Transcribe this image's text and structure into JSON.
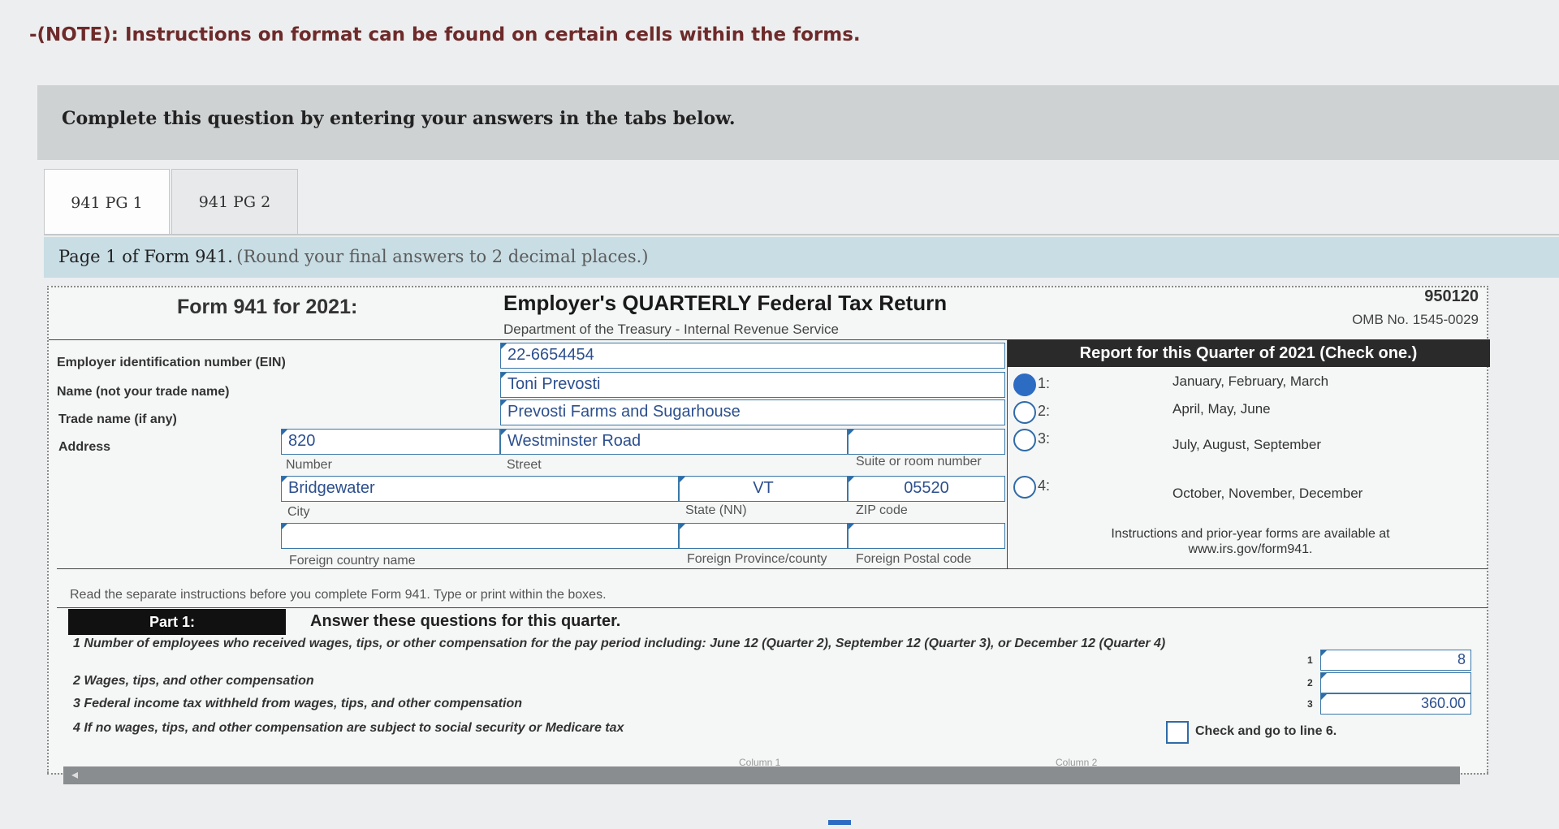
{
  "note": "-(NOTE): Instructions on format can be found on certain cells within the forms.",
  "prompt": "Complete this question by entering your answers in the tabs below.",
  "tabs": [
    {
      "label": "941 PG 1",
      "active": true
    },
    {
      "label": "941 PG 2",
      "active": false
    }
  ],
  "instructions": {
    "lead": "Page 1 of Form 941.",
    "paren": "(Round your final answers to 2 decimal places.)"
  },
  "form": {
    "title": "Form 941 for 2021:",
    "subject": "Employer's QUARTERLY Federal Tax Return",
    "department": "Department of the Treasury - Internal Revenue Service",
    "code": "950120",
    "omb": "OMB No. 1545-0029",
    "labels": {
      "ein": "Employer identification number (EIN)",
      "name": "Name (not your trade name)",
      "trade": "Trade name (if any)",
      "address": "Address"
    },
    "values": {
      "ein": "22-6654454",
      "name": "Toni Prevosti",
      "trade": "Prevosti Farms and Sugarhouse",
      "number": "820",
      "street": "Westminster Road",
      "suite": "",
      "city": "Bridgewater",
      "state": "VT",
      "zip": "05520",
      "foreign_country": "",
      "foreign_province": "",
      "foreign_postal": ""
    },
    "sublabels": {
      "number": "Number",
      "street": "Street",
      "suite": "Suite or room number",
      "city": "City",
      "state": "State (NN)",
      "zip": "ZIP code",
      "foreign_country": "Foreign country name",
      "foreign_province": "Foreign Province/county",
      "foreign_postal": "Foreign Postal code"
    },
    "quarter": {
      "heading": "Report for this Quarter of 2021 (Check one.)",
      "options": [
        {
          "num": "1:",
          "label": "January, February, March",
          "selected": true
        },
        {
          "num": "2:",
          "label": "April, May, June",
          "selected": false
        },
        {
          "num": "3:",
          "label": "July, August, September",
          "selected": false
        },
        {
          "num": "4:",
          "label": "October, November, December",
          "selected": false
        }
      ],
      "footer": "Instructions and prior-year forms are available at www.irs.gov/form941."
    },
    "read_note": "Read the separate instructions before you complete Form 941. Type or print within the boxes.",
    "part": {
      "label": "Part 1:",
      "title": "Answer these questions for this quarter."
    },
    "lines": [
      {
        "num": "1",
        "text": "1  Number of employees who received wages, tips, or other compensation for the pay period including:  June 12 (Quarter 2), September 12 (Quarter 3), or December 12 (Quarter 4)",
        "value": "8"
      },
      {
        "num": "2",
        "text": "2  Wages, tips, and other compensation",
        "value": ""
      },
      {
        "num": "3",
        "text": "3  Federal income tax withheld from wages, tips, and other compensation",
        "value": "360.00"
      },
      {
        "num": "4",
        "text": "4  If no wages, tips, and other compensation are subject to social security or Medicare tax",
        "check_label": "Check and go to line 6."
      }
    ],
    "columns_hint": [
      "Column 1",
      "Column 2"
    ]
  },
  "colors": {
    "accent": "#2d6cc3",
    "field_text": "#2c4f8e",
    "note_text": "#6e2a2a",
    "instr_bar": "#c8dde4"
  }
}
